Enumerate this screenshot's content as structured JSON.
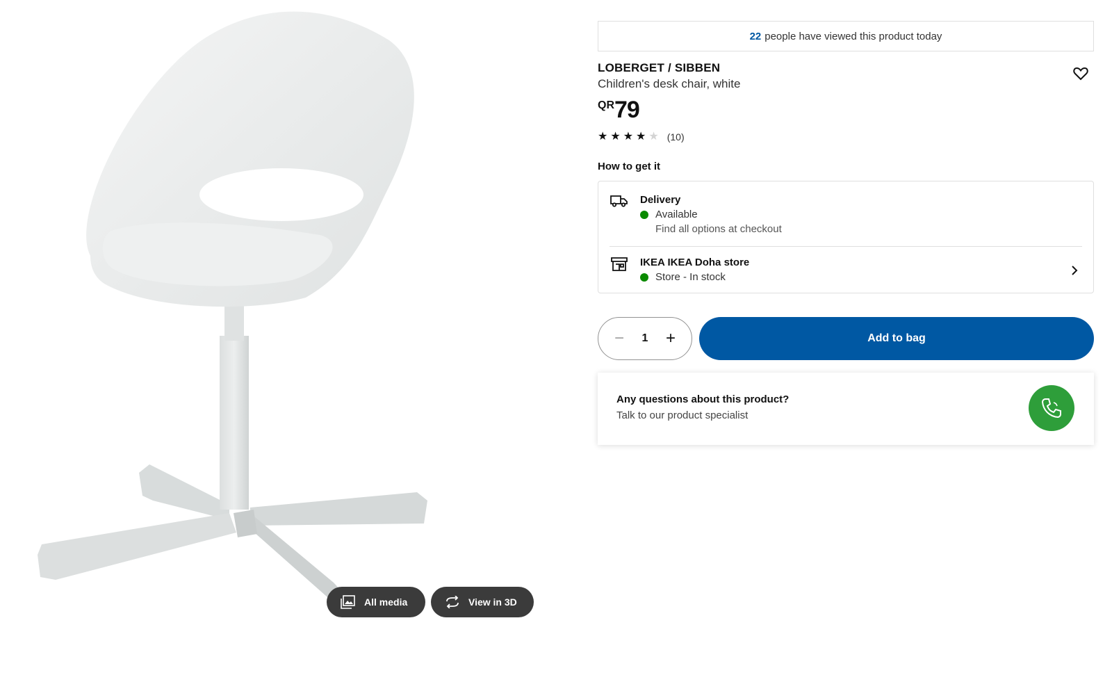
{
  "media": {
    "all_media_label": "All media",
    "view_3d_label": "View in 3D",
    "product_image_icon": "chair-image"
  },
  "viewed": {
    "count": "22",
    "text": "people have viewed this product today"
  },
  "product": {
    "name": "LOBERGET / SIBBEN",
    "description": "Children's desk chair, white",
    "currency": "QR",
    "price": "79",
    "rating_stars": 4,
    "rating_max": 5,
    "review_count": "(10)"
  },
  "how_to_get": {
    "heading": "How to get it",
    "delivery": {
      "label": "Delivery",
      "status": "Available",
      "sub": "Find all options at checkout",
      "icon": "truck-icon"
    },
    "store": {
      "label": "IKEA IKEA Doha store",
      "status": "Store - In stock",
      "icon": "store-icon"
    }
  },
  "purchase": {
    "quantity": "1",
    "minus_symbol": "−",
    "plus_symbol": "+",
    "add_label": "Add to bag"
  },
  "questions": {
    "title": "Any questions about this product?",
    "subtitle": "Talk to our product specialist"
  },
  "colors": {
    "brand_blue": "#0058a3",
    "available_green": "#0a8a00",
    "call_green": "#2e9e3a",
    "media_button_bg": "#3b3b3b"
  }
}
